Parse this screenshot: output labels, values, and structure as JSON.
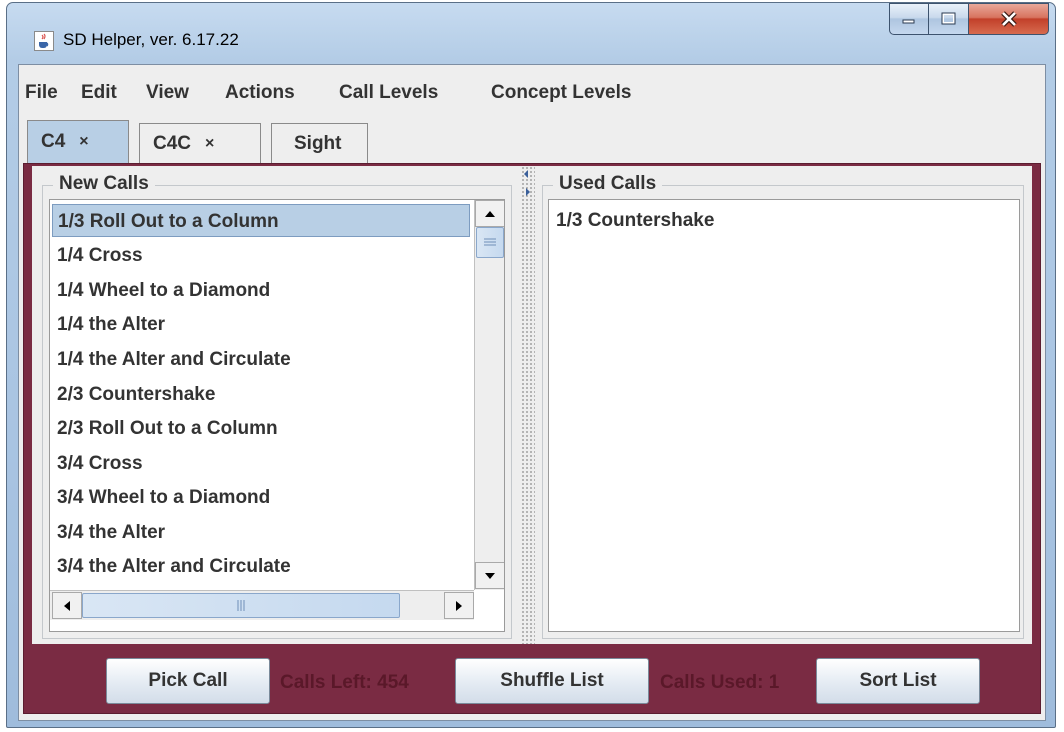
{
  "window": {
    "title": "SD Helper, ver. 6.17.22",
    "icon": "java-cup-icon"
  },
  "menu": {
    "items": [
      "File",
      "Edit",
      "View",
      "Actions",
      "Call Levels",
      "Concept Levels"
    ]
  },
  "tabs": [
    {
      "label": "C4",
      "closable": true,
      "active": true
    },
    {
      "label": "C4C",
      "closable": true,
      "active": false
    },
    {
      "label": "Sight",
      "closable": false,
      "active": false
    }
  ],
  "close_glyph": "×",
  "new_calls": {
    "title": "New Calls",
    "items": [
      "1/3 Roll Out to a Column",
      "1/4 Cross",
      "1/4 Wheel to a Diamond",
      "1/4 the Alter",
      "1/4 the Alter and Circulate",
      "2/3 Countershake",
      "2/3 Roll Out to a Column",
      "3/4 Cross",
      "3/4 Wheel to a Diamond",
      "3/4 the Alter",
      "3/4 the Alter and Circulate"
    ],
    "selected_index": 0
  },
  "used_calls": {
    "title": "Used Calls",
    "items": [
      "1/3 Countershake"
    ]
  },
  "actions": {
    "pick_call": "Pick Call",
    "calls_left": "Calls Left: 454",
    "shuffle_list": "Shuffle List",
    "calls_used": "Calls Used: 1",
    "sort_list": "Sort List"
  },
  "colors": {
    "panel": "#7a2b43",
    "selection": "#b8cfe5",
    "status_text": "#5a1829"
  }
}
